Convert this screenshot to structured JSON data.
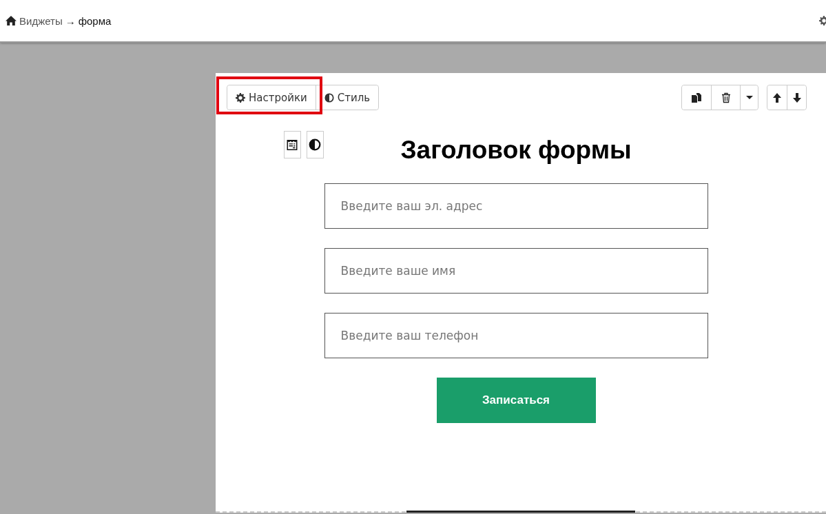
{
  "breadcrumb": {
    "parent": "Виджеты",
    "separator": "→",
    "current": "форма"
  },
  "tabs": [
    {
      "label": "Настройки",
      "highlighted": true
    },
    {
      "label": "Стиль",
      "highlighted": false
    }
  ],
  "form": {
    "title": "Заголовок формы",
    "fields": [
      {
        "placeholder": "Введите ваш эл. адрес"
      },
      {
        "placeholder": "Введите ваше имя"
      },
      {
        "placeholder": "Введите ваш телефон"
      }
    ],
    "submit": "Записаться"
  }
}
